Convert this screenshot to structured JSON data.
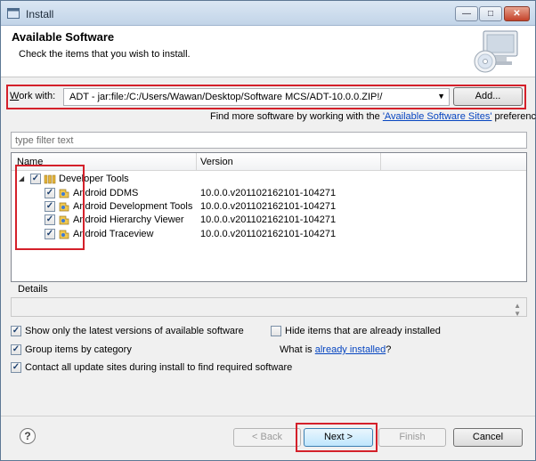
{
  "window": {
    "title": "Install",
    "controls": {
      "minimize": "—",
      "maximize": "□",
      "close": "✕"
    }
  },
  "header": {
    "title": "Available Software",
    "description": "Check the items that you wish to install."
  },
  "work_with": {
    "label_prefix": "W",
    "label_rest": "ork with:",
    "value": "ADT - jar:file:/C:/Users/Wawan/Desktop/Software MCS/ADT-10.0.0.ZIP!/",
    "add_button": "Add..."
  },
  "find_more": {
    "prefix": "Find more software by working with the ",
    "link": "'Available Software Sites'",
    "suffix": " preferences."
  },
  "filter": {
    "placeholder": "type filter text"
  },
  "tree": {
    "columns": {
      "name": "Name",
      "version": "Version"
    },
    "group": {
      "label": "Developer Tools",
      "checked": true,
      "expanded": true
    },
    "items": [
      {
        "label": "Android DDMS",
        "version": "10.0.0.v201102162101-104271",
        "checked": true
      },
      {
        "label": "Android Development Tools",
        "version": "10.0.0.v201102162101-104271",
        "checked": true
      },
      {
        "label": "Android Hierarchy Viewer",
        "version": "10.0.0.v201102162101-104271",
        "checked": true
      },
      {
        "label": "Android Traceview",
        "version": "10.0.0.v201102162101-104271",
        "checked": true
      }
    ]
  },
  "details": {
    "label": "Details"
  },
  "options": {
    "show_latest": {
      "label": "Show only the latest versions of available software",
      "checked": true
    },
    "hide_installed": {
      "label": "Hide items that are already installed",
      "checked": false
    },
    "group_by_category": {
      "label": "Group items by category",
      "checked": true
    },
    "what_is": {
      "prefix": "What is ",
      "link": "already installed",
      "suffix": "?"
    },
    "contact_sites": {
      "label": "Contact all update sites during install to find required software",
      "checked": true
    }
  },
  "footer": {
    "help": "?",
    "back": "< Back",
    "next": "Next >",
    "finish": "Finish",
    "cancel": "Cancel"
  },
  "colors": {
    "highlight": "#d4202a",
    "link": "#0645c0"
  },
  "icons": [
    "install-window-icon",
    "cd-computer-icon",
    "dropdown-arrow-icon",
    "folder-group-icon",
    "plugin-icon",
    "help-icon"
  ]
}
